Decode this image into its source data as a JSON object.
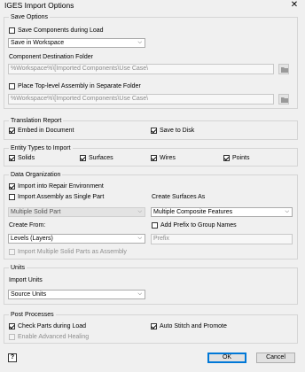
{
  "window": {
    "title": "IGES Import Options",
    "close_glyph": "✕"
  },
  "save_options": {
    "title": "Save Options",
    "save_components": {
      "label": "Save Components during Load",
      "checked": false
    },
    "save_mode": {
      "value": "Save in Workspace",
      "icon": "chevron-down-icon"
    },
    "destination_label": "Component Destination Folder",
    "destination_path": "%Workspace%\\[Imported Components\\Use Case\\",
    "place_top_level": {
      "label": "Place Top-level Assembly in Separate Folder",
      "checked": false
    },
    "top_level_path": "%Workspace%\\[Imported Components\\Use Case\\"
  },
  "translation_report": {
    "title": "Translation Report",
    "embed": {
      "label": "Embed in Document",
      "checked": true
    },
    "save_disk": {
      "label": "Save to Disk",
      "checked": true
    }
  },
  "entity_types": {
    "title": "Entity Types to Import",
    "solids": {
      "label": "Solids",
      "checked": true
    },
    "surfaces": {
      "label": "Surfaces",
      "checked": true
    },
    "wires": {
      "label": "Wires",
      "checked": true
    },
    "points": {
      "label": "Points",
      "checked": true
    }
  },
  "data_org": {
    "title": "Data Organization",
    "repair_env": {
      "label": "Import into Repair Environment",
      "checked": true
    },
    "single_part": {
      "label": "Import Assembly as Single Part",
      "checked": false
    },
    "single_part_mode": {
      "value": "Multiple Solid Part"
    },
    "create_surfaces_label": "Create Surfaces As",
    "create_surfaces_value": "Multiple Composite Features",
    "create_from_label": "Create From:",
    "create_from_value": "Levels (Layers)",
    "add_prefix": {
      "label": "Add Prefix to Group Names",
      "checked": false
    },
    "prefix_placeholder": "Prefix",
    "multi_solid": {
      "label": "Import Multiple Solid Parts as Assembly",
      "checked": false
    }
  },
  "units": {
    "title": "Units",
    "import_units_label": "Import Units",
    "import_units_value": "Source Units"
  },
  "post_processes": {
    "title": "Post Processes",
    "check_parts": {
      "label": "Check Parts during Load",
      "checked": true
    },
    "auto_stitch": {
      "label": "Auto Stitch and Promote",
      "checked": true
    },
    "advanced_healing": {
      "label": "Enable Advanced Healing",
      "checked": false
    }
  },
  "footer": {
    "help_glyph": "?",
    "ok_label": "OK",
    "cancel_label": "Cancel"
  }
}
